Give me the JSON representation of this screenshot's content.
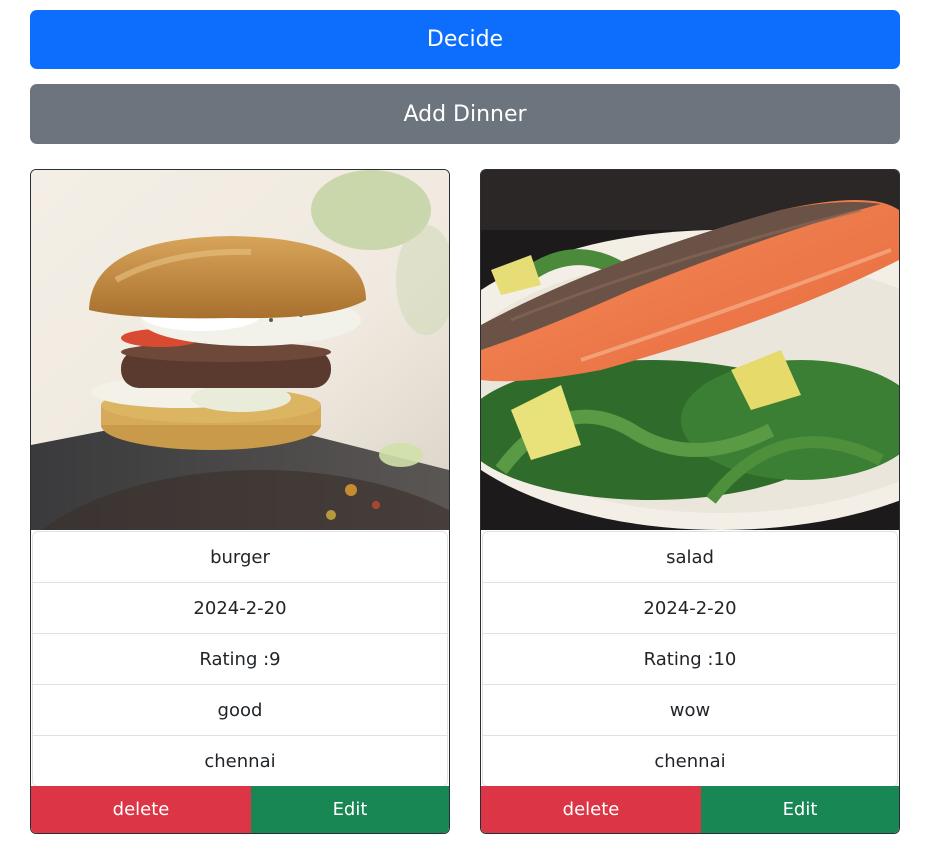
{
  "buttons": {
    "decide": "Decide",
    "add_dinner": "Add Dinner"
  },
  "cards": [
    {
      "name": "burger",
      "date": "2024-2-20",
      "rating": "Rating :9",
      "review": "good",
      "location": "chennai",
      "delete_label": "delete",
      "edit_label": "Edit"
    },
    {
      "name": "salad",
      "date": "2024-2-20",
      "rating": "Rating :10",
      "review": "wow",
      "location": "chennai",
      "delete_label": "delete",
      "edit_label": "Edit"
    }
  ],
  "colors": {
    "primary": "#0d6efd",
    "secondary": "#6c757d",
    "danger": "#dc3545",
    "success": "#198754"
  }
}
